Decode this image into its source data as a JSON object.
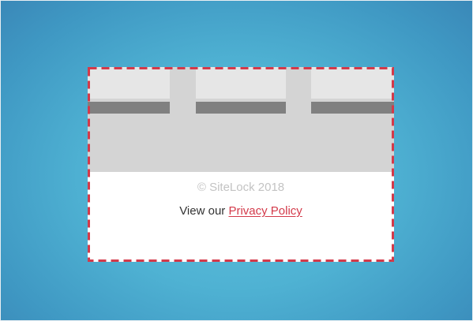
{
  "footer": {
    "copyright": "© SiteLock 2018",
    "privacy_prefix": "View our ",
    "privacy_link": "Privacy Policy"
  },
  "columns": [
    {
      "name": "footer-column-1"
    },
    {
      "name": "footer-column-2"
    },
    {
      "name": "footer-column-3"
    }
  ],
  "colors": {
    "background": "#4fb2d3",
    "dashed_border": "#d33a4a",
    "link": "#d33a4a",
    "placeholder_light": "#e6e6e6",
    "placeholder_dark": "#808080",
    "placeholder_mid": "#d4d4d4"
  }
}
